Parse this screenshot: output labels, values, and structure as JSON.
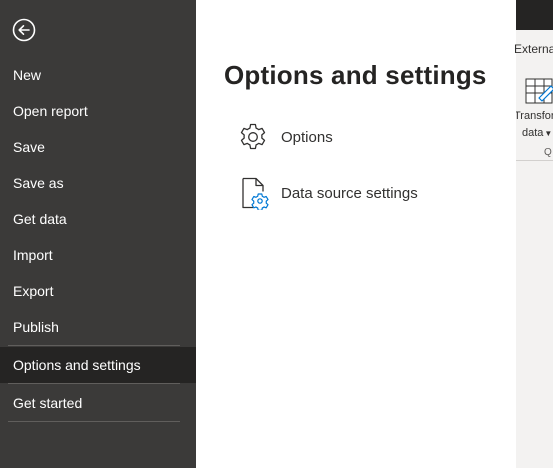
{
  "nav": {
    "back_label": "Back",
    "items": [
      {
        "label": "New"
      },
      {
        "label": "Open report"
      },
      {
        "label": "Save"
      },
      {
        "label": "Save as"
      },
      {
        "label": "Get data"
      },
      {
        "label": "Import"
      },
      {
        "label": "Export"
      },
      {
        "label": "Publish"
      },
      {
        "label": "Options and settings"
      },
      {
        "label": "Get started"
      }
    ],
    "selected": "Options and settings"
  },
  "main": {
    "title": "Options and settings",
    "options": [
      {
        "label": "Options",
        "icon": "gear-icon"
      },
      {
        "label": "Data source settings",
        "icon": "data-source-settings-icon"
      }
    ]
  },
  "ribbon": {
    "group_label": "Externa",
    "transform_label_line1": "Transfor",
    "transform_label_line2": "data",
    "section_label": "Q"
  },
  "colors": {
    "nav_bg": "#3b3a39",
    "nav_selected_bg": "#252423",
    "main_bg": "#ffffff",
    "accent": "#0078d4"
  }
}
